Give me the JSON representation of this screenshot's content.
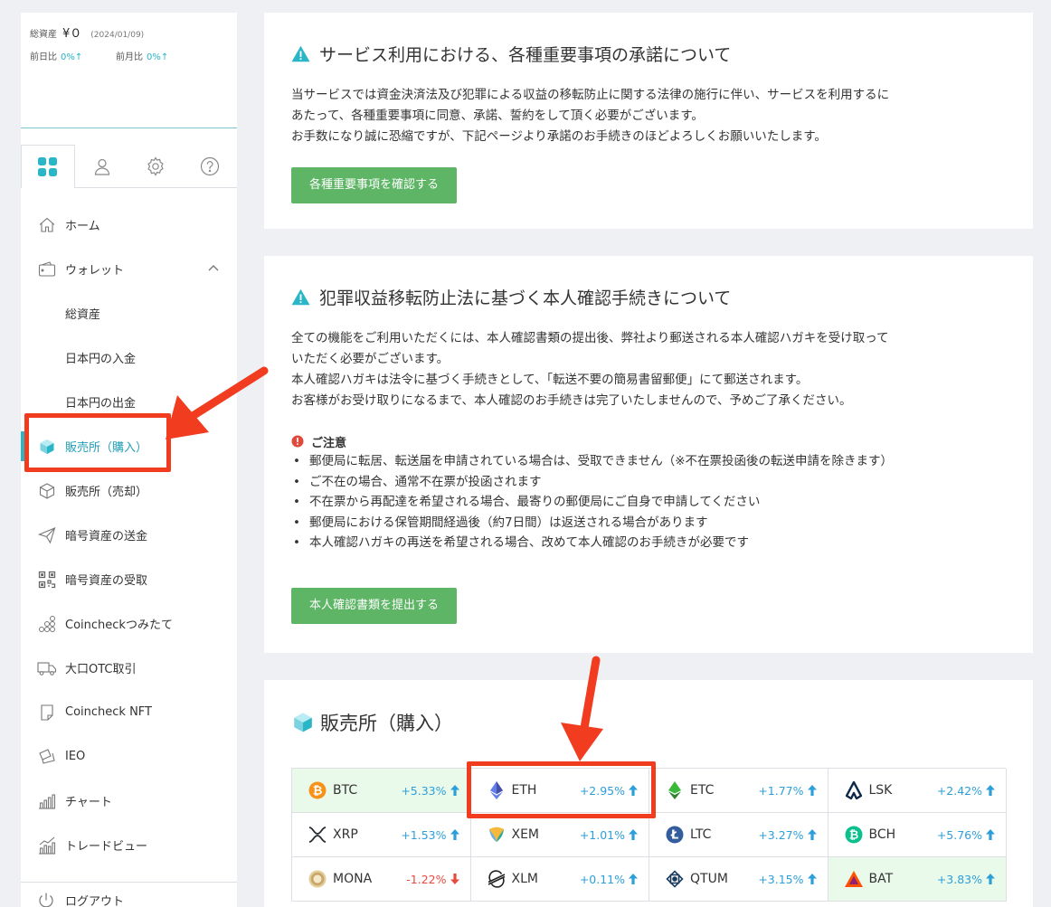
{
  "assets": {
    "total_label": "総資産",
    "total_value": "¥０",
    "date": "(2024/01/09)",
    "day_label": "前日比",
    "day_value": "0%↑",
    "month_label": "前月比",
    "month_value": "0%↑"
  },
  "tabs": [
    {
      "icon": "dashboard-grid-icon",
      "active": true
    },
    {
      "icon": "user-icon"
    },
    {
      "icon": "gear-icon"
    },
    {
      "icon": "help-icon"
    }
  ],
  "nav": {
    "home": "ホーム",
    "wallet": "ウォレット",
    "total_assets": "総資産",
    "jpy_deposit": "日本円の入金",
    "jpy_withdraw": "日本円の出金",
    "buy": "販売所（購入）",
    "sell": "販売所（売却）",
    "send": "暗号資産の送金",
    "receive": "暗号資産の受取",
    "tsumitate": "Coincheckつみたて",
    "otc": "大口OTC取引",
    "nft": "Coincheck NFT",
    "ieo": "IEO",
    "chart": "チャート",
    "tradeview": "トレードビュー",
    "logout": "ログアウト"
  },
  "card1": {
    "title": "サービス利用における、各種重要事項の承諾について",
    "line1": "当サービスでは資金決済法及び犯罪による収益の移転防止に関する法律の施行に伴い、サービスを利用するに",
    "line2": "あたって、各種重要事項に同意、承諾、誓約をして頂く必要がございます。",
    "line3": "お手数になり誠に恐縮ですが、下記ページより承諾のお手続きのほどよろしくお願いいたします。",
    "button": "各種重要事項を確認する"
  },
  "card2": {
    "title": "犯罪収益移転防止法に基づく本人確認手続きについて",
    "line1": "全ての機能をご利用いただくには、本人確認書類の提出後、弊社より郵送される本人確認ハガキを受け取って",
    "line2": "いただく必要がございます。",
    "line3": "本人確認ハガキは法令に基づく手続きとして、「転送不要の簡易書留郵便」にて郵送されます。",
    "line4": "お客様がお受け取りになるまで、本人確認のお手続きは完了いたしませんので、予めご了承ください。",
    "notice_title": "ご注意",
    "bullets": [
      "郵便局に転居、転送届を申請されている場合は、受取できません（※不在票投函後の転送申請を除きます）",
      "ご不在の場合、通常不在票が投函されます",
      "不在票から再配達を希望される場合、最寄りの郵便局にご自身で申請してください",
      "郵便局における保管期間経過後（約7日間）は返送される場合があります",
      "本人確認ハガキの再送を希望される場合、改めて本人確認のお手続きが必要です"
    ],
    "button": "本人確認書類を提出する"
  },
  "card3": {
    "title": "販売所（購入）"
  },
  "coins": [
    {
      "name": "BTC",
      "change": "+5.33%",
      "dir": "up",
      "color": "#f7931a"
    },
    {
      "name": "ETH",
      "change": "+2.95%",
      "dir": "up",
      "color": "#627eea"
    },
    {
      "name": "ETC",
      "change": "+1.77%",
      "dir": "up",
      "color": "#3ab83a"
    },
    {
      "name": "LSK",
      "change": "+2.42%",
      "dir": "up",
      "color": "#0d2a4a"
    },
    {
      "name": "XRP",
      "change": "+1.53%",
      "dir": "up",
      "color": "#23292f"
    },
    {
      "name": "XEM",
      "change": "+1.01%",
      "dir": "up",
      "color": "#67b2e8"
    },
    {
      "name": "LTC",
      "change": "+3.27%",
      "dir": "up",
      "color": "#345d9d"
    },
    {
      "name": "BCH",
      "change": "+5.76%",
      "dir": "up",
      "color": "#0ac18e"
    },
    {
      "name": "MONA",
      "change": "-1.22%",
      "dir": "down",
      "color": "#c9a66b"
    },
    {
      "name": "XLM",
      "change": "+0.11%",
      "dir": "up",
      "color": "#222"
    },
    {
      "name": "QTUM",
      "change": "+3.15%",
      "dir": "up",
      "color": "#2e9ad0"
    },
    {
      "name": "BAT",
      "change": "+3.83%",
      "dir": "up",
      "color": "#ff5000"
    }
  ],
  "colors": {
    "accent": "#2bb6c8",
    "button_green": "#5db565",
    "up_blue": "#2d9fd9",
    "down_red": "#e84a3f",
    "annotation_red": "#f23c20"
  }
}
